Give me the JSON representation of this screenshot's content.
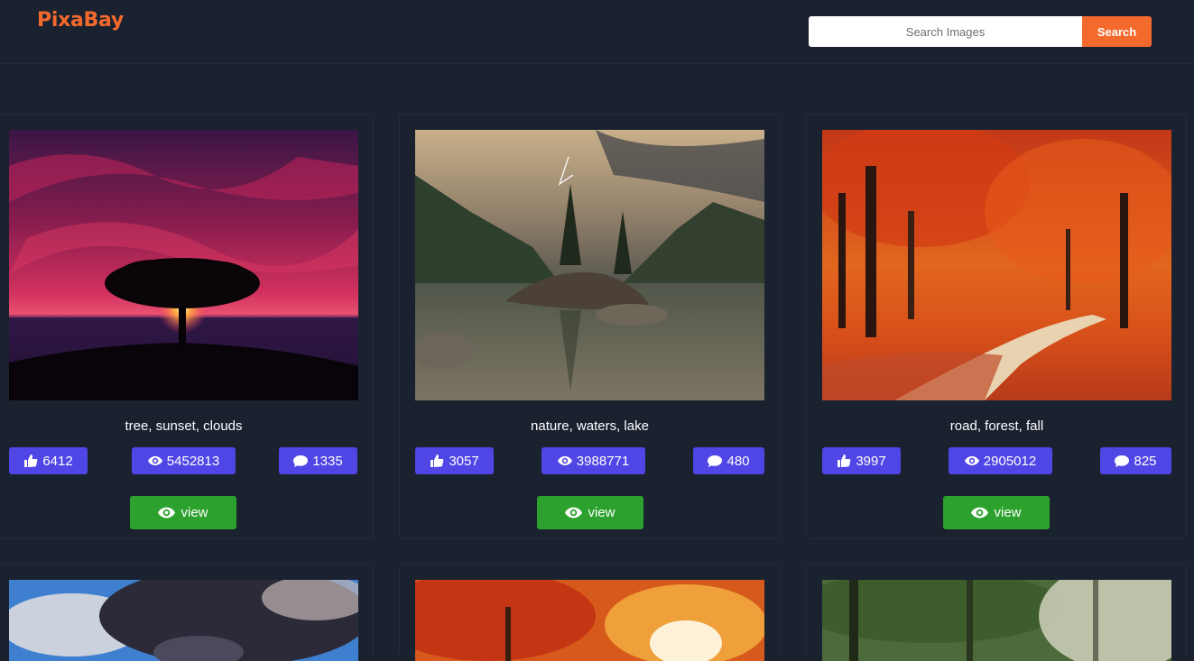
{
  "app": {
    "brand": "PixaBay"
  },
  "search": {
    "placeholder": "Search Images",
    "value": "",
    "button_label": "Search"
  },
  "colors": {
    "accent": "#f4692c",
    "stat_badge": "#5046e5",
    "view_button": "#2da12d",
    "background": "#1a2230"
  },
  "cards": [
    {
      "tags": "tree, sunset, clouds",
      "likes": "6412",
      "views": "5452813",
      "comments": "1335",
      "view_label": "view"
    },
    {
      "tags": "nature, waters, lake",
      "likes": "3057",
      "views": "3988771",
      "comments": "480",
      "view_label": "view"
    },
    {
      "tags": "road, forest, fall",
      "likes": "3997",
      "views": "2905012",
      "comments": "825",
      "view_label": "view"
    }
  ],
  "icons": {
    "likes": "thumbs-up-icon",
    "views": "eye-icon",
    "comments": "comment-icon",
    "view": "eye-icon"
  }
}
